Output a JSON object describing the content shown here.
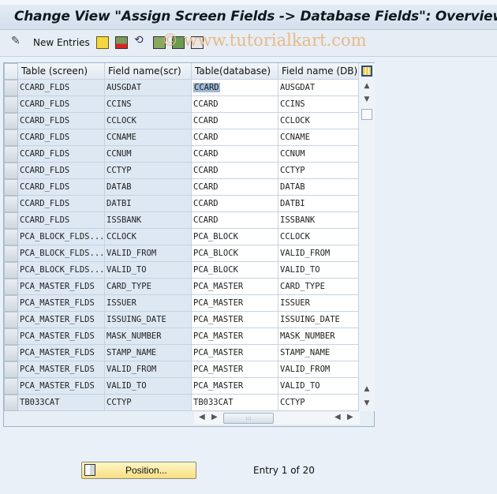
{
  "title": "Change View \"Assign Screen Fields -> Database Fields\": Overview",
  "toolbar": {
    "new_entries": "New Entries",
    "watermark": "© www.tutorialkart.com"
  },
  "table": {
    "headers": [
      "Table (screen)",
      "Field name(scr)",
      "Table(database)",
      "Field name (DB)"
    ],
    "rows": [
      [
        "CCARD_FLDS",
        "AUSGDAT",
        "CCARD",
        "AUSGDAT"
      ],
      [
        "CCARD_FLDS",
        "CCINS",
        "CCARD",
        "CCINS"
      ],
      [
        "CCARD_FLDS",
        "CCLOCK",
        "CCARD",
        "CCLOCK"
      ],
      [
        "CCARD_FLDS",
        "CCNAME",
        "CCARD",
        "CCNAME"
      ],
      [
        "CCARD_FLDS",
        "CCNUM",
        "CCARD",
        "CCNUM"
      ],
      [
        "CCARD_FLDS",
        "CCTYP",
        "CCARD",
        "CCTYP"
      ],
      [
        "CCARD_FLDS",
        "DATAB",
        "CCARD",
        "DATAB"
      ],
      [
        "CCARD_FLDS",
        "DATBI",
        "CCARD",
        "DATBI"
      ],
      [
        "CCARD_FLDS",
        "ISSBANK",
        "CCARD",
        "ISSBANK"
      ],
      [
        "PCA_BLOCK_FLDS...",
        "CCLOCK",
        "PCA_BLOCK",
        "CCLOCK"
      ],
      [
        "PCA_BLOCK_FLDS...",
        "VALID_FROM",
        "PCA_BLOCK",
        "VALID_FROM"
      ],
      [
        "PCA_BLOCK_FLDS...",
        "VALID_TO",
        "PCA_BLOCK",
        "VALID_TO"
      ],
      [
        "PCA_MASTER_FLDS",
        "CARD_TYPE",
        "PCA_MASTER",
        "CARD_TYPE"
      ],
      [
        "PCA_MASTER_FLDS",
        "ISSUER",
        "PCA_MASTER",
        "ISSUER"
      ],
      [
        "PCA_MASTER_FLDS",
        "ISSUING_DATE",
        "PCA_MASTER",
        "ISSUING_DATE"
      ],
      [
        "PCA_MASTER_FLDS",
        "MASK_NUMBER",
        "PCA_MASTER",
        "MASK_NUMBER"
      ],
      [
        "PCA_MASTER_FLDS",
        "STAMP_NAME",
        "PCA_MASTER",
        "STAMP_NAME"
      ],
      [
        "PCA_MASTER_FLDS",
        "VALID_FROM",
        "PCA_MASTER",
        "VALID_FROM"
      ],
      [
        "PCA_MASTER_FLDS",
        "VALID_TO",
        "PCA_MASTER",
        "VALID_TO"
      ],
      [
        "TB033CAT",
        "CCTYP",
        "TB033CAT",
        "CCTYP"
      ]
    ]
  },
  "footer": {
    "position_label": "Position...",
    "entry_text": "Entry 1 of 20"
  }
}
